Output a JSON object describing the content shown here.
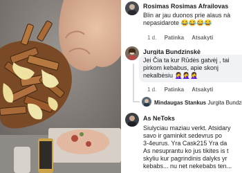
{
  "comments": [
    {
      "author": "Rosimas Rosimas Afrailovas",
      "lines": [
        "Blin ar jau duonos prie alaus nà",
        "nepasidarote 😂😂😂😂"
      ],
      "actions": {
        "time": "1 d.",
        "like": "Patinka",
        "reply": "Atsakyti"
      }
    },
    {
      "author": "Jurgita Bundzinskė",
      "lines": [
        "Jei Čia ta kur Rūdės gatvėj , tai",
        "pirkom kebabus,  apie skonj",
        "nekalbėsiu 🤦‍♀️🤦‍♀️🤦‍♀️"
      ],
      "actions": {
        "time": "1 d.",
        "like": "Patinka",
        "reply": "Atsakyti"
      }
    },
    {
      "author": "Mindaugas Stankus",
      "reply_to": "Jurgita Bundzinsk"
    },
    {
      "author": "As NeToks",
      "lines": [
        "Siulyciau maziau verkt. Atsidary",
        "savo ir gaminkit sedevrus po",
        "3-4eurus.  Yra Cask215  Yra da",
        "As nesuprantu ko jus tikites is t",
        "skyliu kur pagrindinis dalyks yr",
        "kebabs... nu net nekebabs ten..."
      ]
    }
  ],
  "colors": {
    "text": "#1c1e21",
    "meta": "#65676b",
    "bubble": "#f0f2f5"
  }
}
